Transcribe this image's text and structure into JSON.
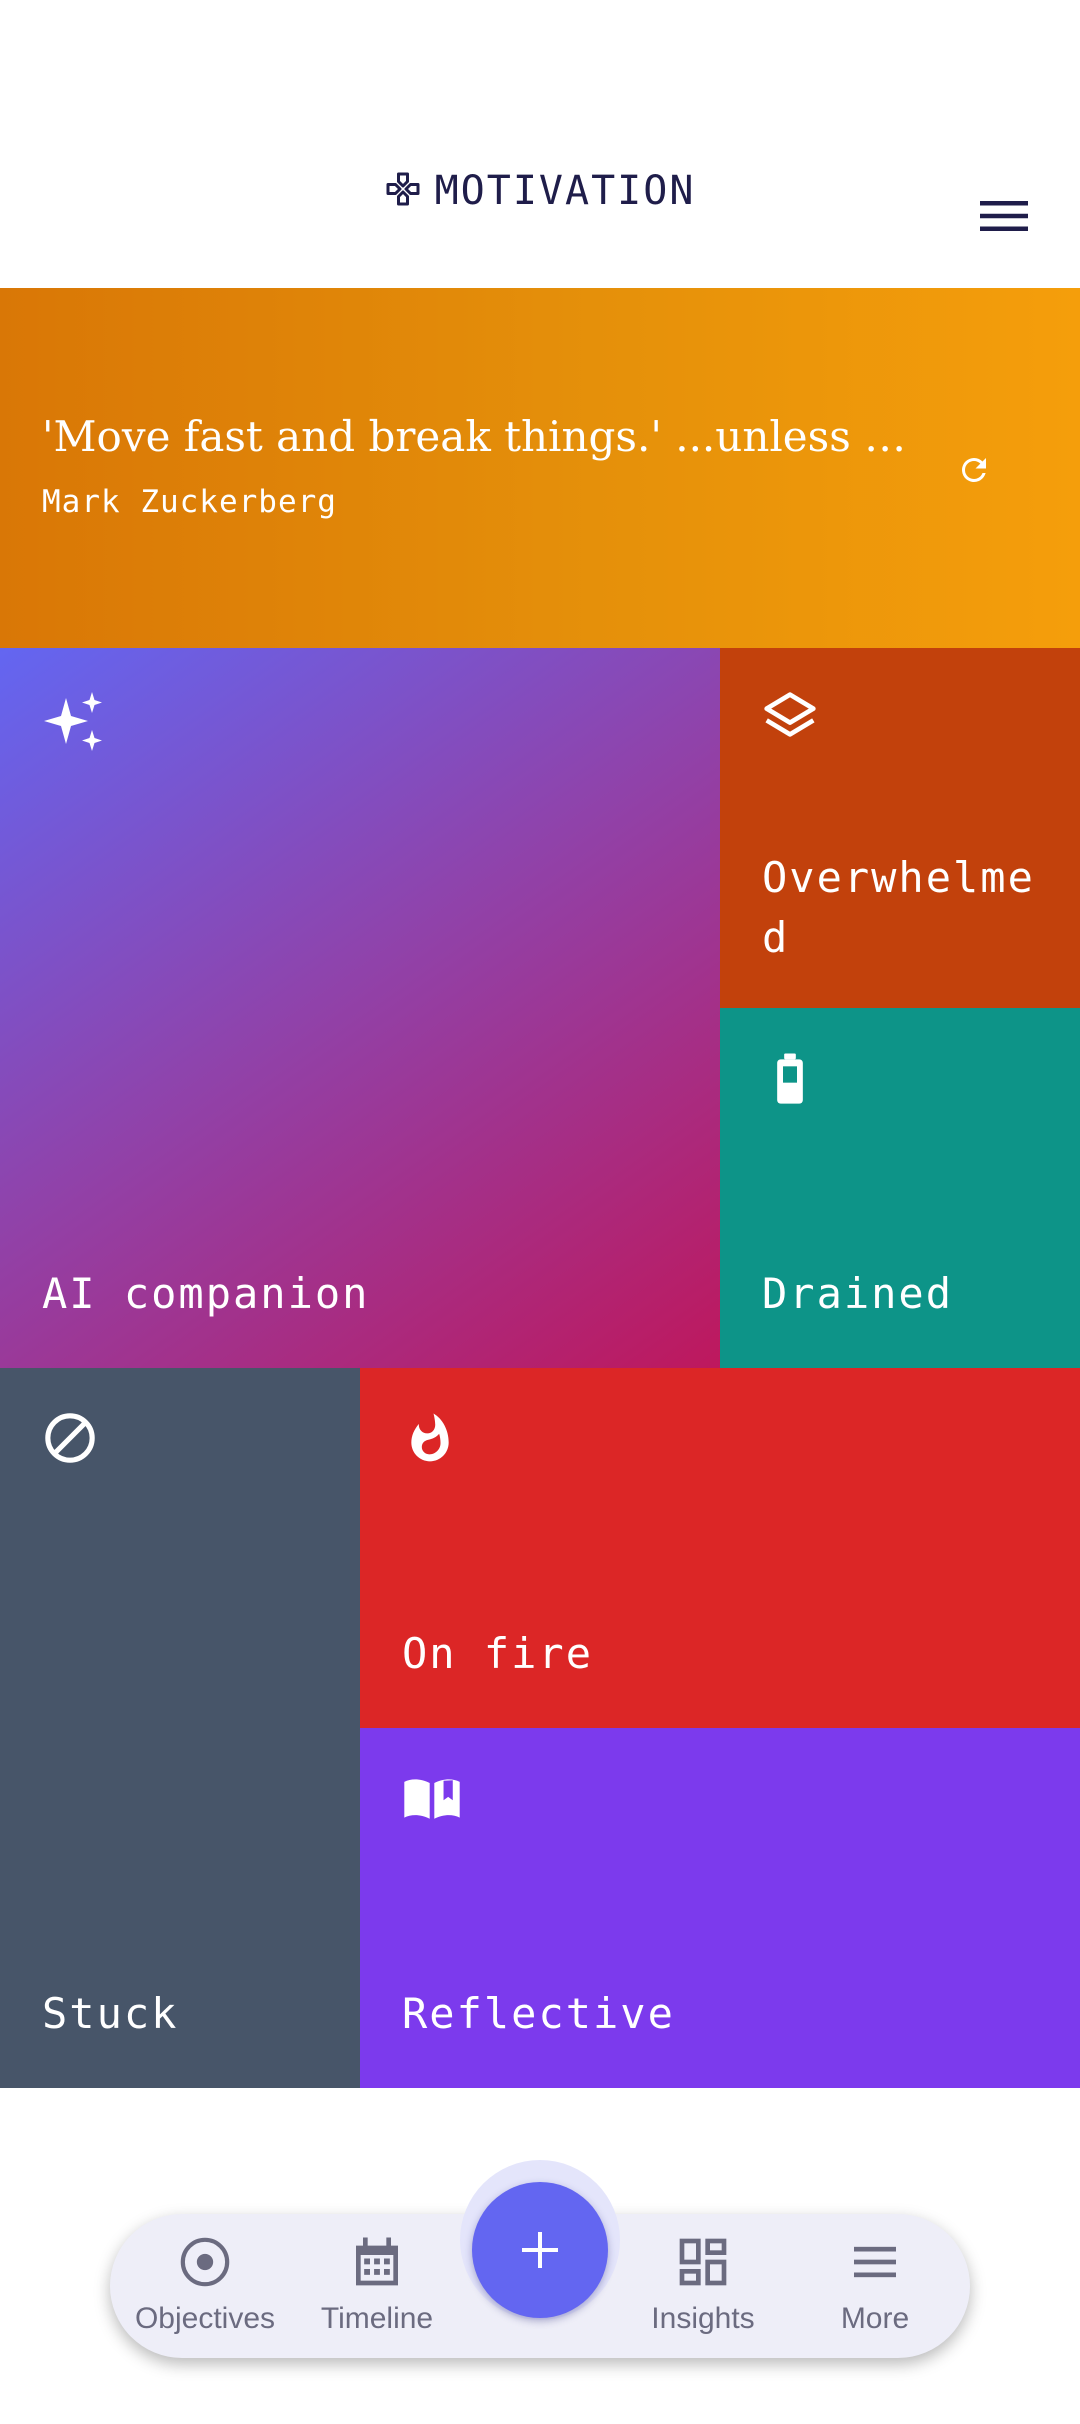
{
  "header": {
    "title": "MOTIVATION",
    "logo_icon": "gamepad-icon",
    "menu_icon": "hamburger-menu-icon"
  },
  "quote": {
    "text": "'Move fast and break things.' ...unless you...",
    "author": "Mark Zuckerberg",
    "refresh_icon": "refresh-icon",
    "colors": {
      "start": "#d97706",
      "end": "#f59e0b"
    }
  },
  "tiles": {
    "ai": {
      "label": "AI companion",
      "icon": "sparkles-icon"
    },
    "overwhelmed": {
      "label": "Overwhelmed",
      "icon": "layers-icon",
      "color": "#c2410c"
    },
    "drained": {
      "label": "Drained",
      "icon": "battery-icon",
      "color": "#0d9488"
    },
    "stuck": {
      "label": "Stuck",
      "icon": "block-icon",
      "color": "#475569"
    },
    "on_fire": {
      "label": "On fire",
      "icon": "flame-icon",
      "color": "#dc2626"
    },
    "reflective": {
      "label": "Reflective",
      "icon": "open-book-icon",
      "color": "#7c3aed"
    }
  },
  "bottom_nav": {
    "items": [
      {
        "label": "Objectives",
        "icon": "target-icon"
      },
      {
        "label": "Timeline",
        "icon": "calendar-icon"
      },
      {
        "label": "Insights",
        "icon": "dashboard-icon"
      },
      {
        "label": "More",
        "icon": "menu-icon"
      }
    ],
    "fab_icon": "plus-icon",
    "accent": "#6366f1"
  }
}
